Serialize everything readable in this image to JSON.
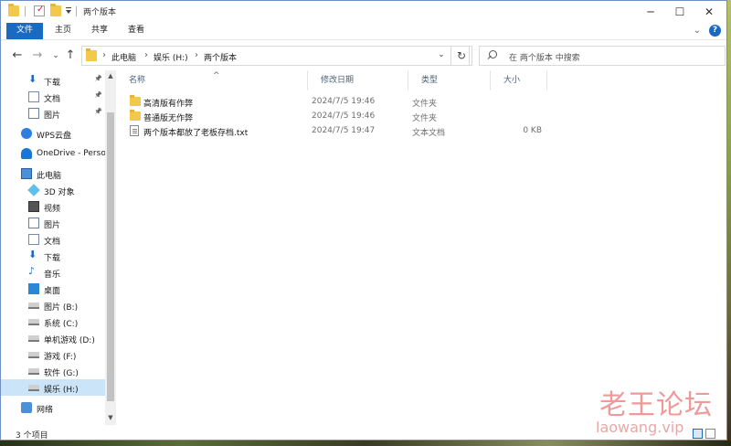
{
  "window": {
    "title": "两个版本",
    "controls": [
      "minimize",
      "maximize",
      "close"
    ]
  },
  "ribbon": {
    "tabs": [
      "文件",
      "主页",
      "共享",
      "查看"
    ],
    "active_tab": "文件",
    "accent": "#1a6ac2",
    "help_glyph": "?"
  },
  "address_bar": {
    "crumbs": [
      "此电脑",
      "娱乐 (H:)",
      "两个版本"
    ]
  },
  "search": {
    "placeholder": "在 两个版本 中搜索"
  },
  "sidebar": {
    "items": [
      {
        "label": "下载",
        "icon": "download-arrow-icon",
        "pinned": true,
        "indent": 1
      },
      {
        "label": "文档",
        "icon": "document-icon",
        "pinned": true,
        "indent": 1
      },
      {
        "label": "图片",
        "icon": "picture-icon",
        "pinned": true,
        "indent": 1
      },
      {
        "label": "WPS云盘",
        "icon": "wps-cloud-icon",
        "pinned": false,
        "indent": 0
      },
      {
        "label": "OneDrive - Perso",
        "icon": "onedrive-cloud-icon",
        "pinned": false,
        "indent": 0
      },
      {
        "label": "此电脑",
        "icon": "computer-icon",
        "pinned": false,
        "indent": 0
      },
      {
        "label": "3D 对象",
        "icon": "3d-objects-icon",
        "pinned": false,
        "indent": 1
      },
      {
        "label": "视频",
        "icon": "video-icon",
        "pinned": false,
        "indent": 1
      },
      {
        "label": "图片",
        "icon": "picture-icon",
        "pinned": false,
        "indent": 1
      },
      {
        "label": "文档",
        "icon": "document-icon",
        "pinned": false,
        "indent": 1
      },
      {
        "label": "下载",
        "icon": "download-arrow-icon",
        "pinned": false,
        "indent": 1
      },
      {
        "label": "音乐",
        "icon": "music-note-icon",
        "pinned": false,
        "indent": 1
      },
      {
        "label": "桌面",
        "icon": "desktop-icon",
        "pinned": false,
        "indent": 1
      },
      {
        "label": "图片 (B:)",
        "icon": "drive-icon",
        "pinned": false,
        "indent": 1
      },
      {
        "label": "系统 (C:)",
        "icon": "system-drive-icon",
        "pinned": false,
        "indent": 1
      },
      {
        "label": "单机游戏 (D:)",
        "icon": "drive-icon",
        "pinned": false,
        "indent": 1
      },
      {
        "label": "游戏 (F:)",
        "icon": "drive-icon",
        "pinned": false,
        "indent": 1
      },
      {
        "label": "软件 (G:)",
        "icon": "drive-icon",
        "pinned": false,
        "indent": 1
      },
      {
        "label": "娱乐 (H:)",
        "icon": "drive-icon",
        "pinned": false,
        "indent": 1,
        "selected": true
      },
      {
        "label": "网络",
        "icon": "network-icon",
        "pinned": false,
        "indent": 0
      }
    ]
  },
  "file_list": {
    "columns": [
      "名称",
      "修改日期",
      "类型",
      "大小"
    ],
    "rows": [
      {
        "name": "高清版有作弊",
        "date": "2024/7/5 19:46",
        "type": "文件夹",
        "size": "",
        "icon": "folder-icon"
      },
      {
        "name": "普通版无作弊",
        "date": "2024/7/5 19:46",
        "type": "文件夹",
        "size": "",
        "icon": "folder-icon"
      },
      {
        "name": "两个版本都放了老板存档.txt",
        "date": "2024/7/5 19:47",
        "type": "文本文档",
        "size": "0 KB",
        "icon": "text-file-icon"
      }
    ]
  },
  "status_bar": {
    "item_count": "3 个项目"
  },
  "watermark": {
    "cn": "老王论坛",
    "en": "laowang.vip"
  }
}
